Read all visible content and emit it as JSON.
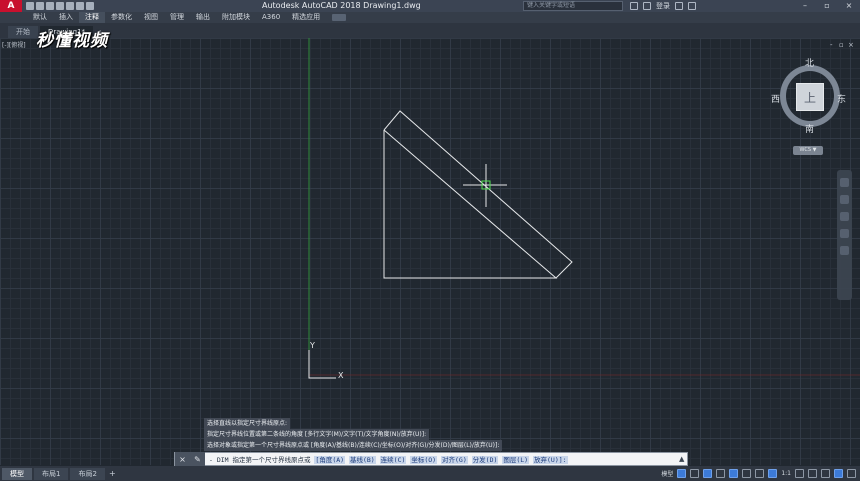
{
  "window": {
    "title": "Autodesk AutoCAD 2018    Drawing1.dwg",
    "search_placeholder": "键入关键字或短语",
    "sign_in": "登录",
    "app_logo": "A"
  },
  "ribbon": {
    "tabs": [
      "默认",
      "插入",
      "注释",
      "参数化",
      "视图",
      "管理",
      "输出",
      "附加模块",
      "A360",
      "精选应用"
    ],
    "active_index": 2
  },
  "file_tabs": {
    "start": "开始",
    "drawing": "Drawing1*"
  },
  "watermark": "秒懂视频",
  "viewport": {
    "label": "[-][俯视]",
    "controls": [
      "-",
      "▫",
      "×"
    ]
  },
  "viewcube": {
    "top": "上",
    "north": "北",
    "south": "南",
    "west": "西",
    "east": "东",
    "wcs": "WCS ▼"
  },
  "ucs": {
    "x": "X",
    "y": "Y"
  },
  "command_history": [
    "选择直线以指定尺寸界线原点:",
    "指定尺寸界线位置或第二条线的角度 [多行文字(M)/文字(T)/文字角度(N)/放弃(U)]:",
    "选择对象或指定第一个尺寸界线原点或 [角度(A)/基线(B)/连续(C)/坐标(O)/对齐(G)/分发(D)/图层(L)/放弃(U)]:"
  ],
  "command_line": {
    "prefix": "- DIM 指定第一个尺寸界线原点或",
    "options": [
      "[角度(A)",
      "基线(B)",
      "连续(C)",
      "坐标(O)",
      "对齐(G)",
      "分发(D)",
      "图层(L)",
      "放弃(U)]:"
    ]
  },
  "layout_tabs": [
    "模型",
    "布局1",
    "布局2"
  ],
  "status_bar": {
    "model": "模型",
    "scale": "1:1"
  },
  "colors": {
    "canvas": "#212830",
    "geometry": "#e6e8ea",
    "crosshair": "#4cdc4c",
    "ucs_y_axis": "#2f8a3a",
    "ucs_x_axis": "#8a2f2f"
  }
}
